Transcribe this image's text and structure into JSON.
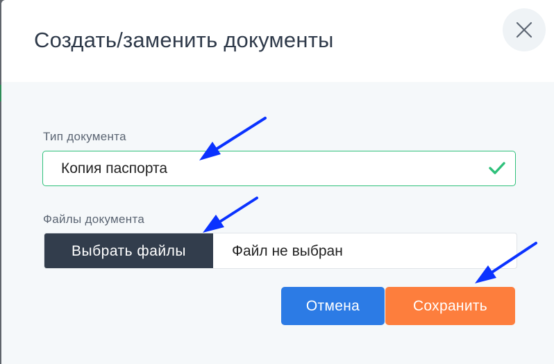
{
  "modal": {
    "title": "Создать/заменить документы"
  },
  "form": {
    "document_type": {
      "label": "Тип документа",
      "value": "Копия паспорта",
      "valid": true
    },
    "document_files": {
      "label": "Файлы документа",
      "choose_label": "Выбрать файлы",
      "status": "Файл не выбран"
    }
  },
  "actions": {
    "cancel_label": "Отмена",
    "save_label": "Сохранить"
  },
  "colors": {
    "primary": "#2c7be5",
    "accent": "#fd7e3d",
    "success": "#2ec07a",
    "dark": "#323d4c",
    "annotation": "#0a32ff"
  },
  "icons": [
    "close-icon",
    "check-icon",
    "annotation-arrow"
  ]
}
